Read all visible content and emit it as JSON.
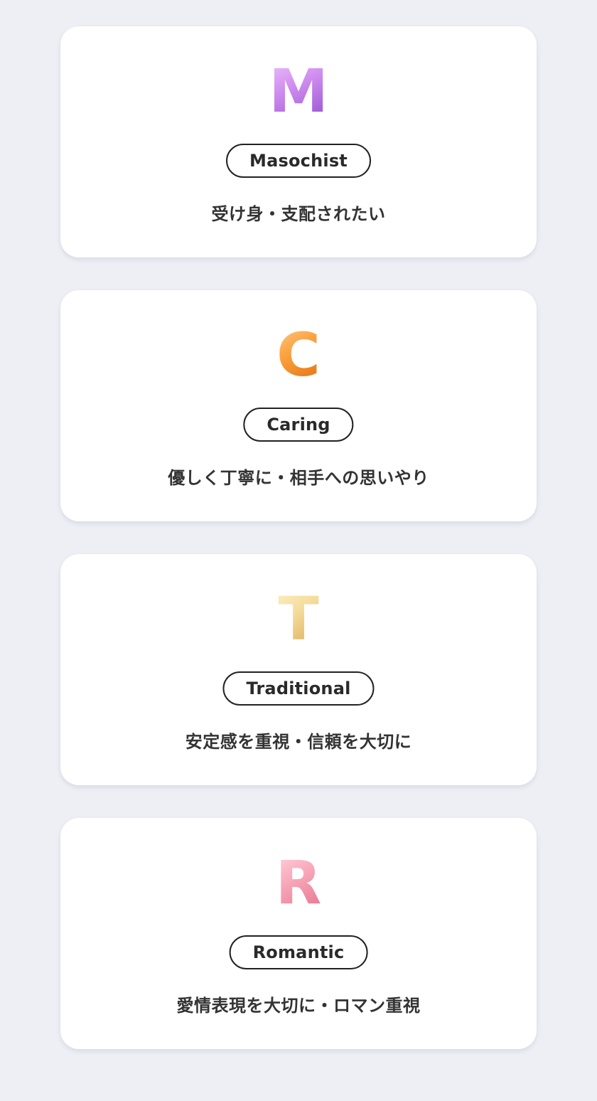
{
  "cards": [
    {
      "letter": "M",
      "icon": "m-letter-icon",
      "colors": {
        "light": "#f1c6fb",
        "mid": "#d08ef0",
        "dark": "#a15ed6"
      },
      "name": "Masochist",
      "description": "受け身・支配されたい"
    },
    {
      "letter": "C",
      "icon": "c-letter-icon",
      "colors": {
        "light": "#ffd49a",
        "mid": "#fba23f",
        "dark": "#e87a17"
      },
      "name": "Caring",
      "description": "優しく丁寧に・相手への思いやり"
    },
    {
      "letter": "T",
      "icon": "t-letter-icon",
      "colors": {
        "light": "#fdf1cb",
        "mid": "#f5dc9a",
        "dark": "#dfb565"
      },
      "name": "Traditional",
      "description": "安定感を重視・信頼を大切に"
    },
    {
      "letter": "R",
      "icon": "r-letter-icon",
      "colors": {
        "light": "#ffd9e2",
        "mid": "#f9a9bb",
        "dark": "#ea7f98"
      },
      "name": "Romantic",
      "description": "愛情表現を大切に・ロマン重視"
    }
  ]
}
